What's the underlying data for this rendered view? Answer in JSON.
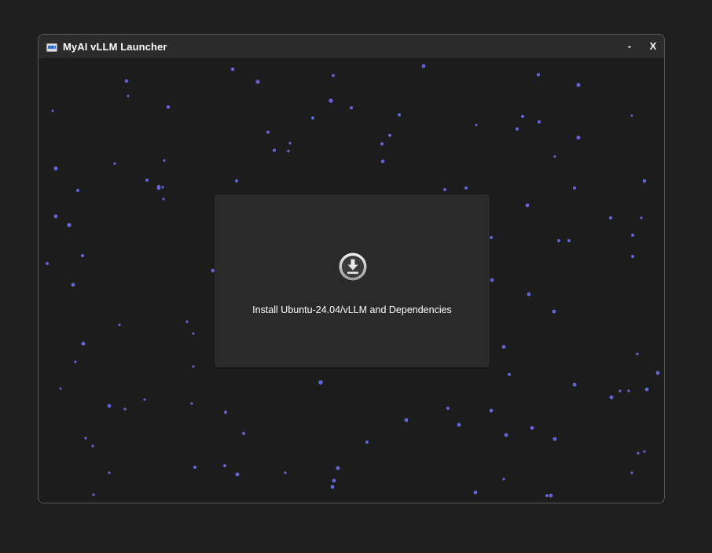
{
  "window": {
    "title": "MyAI vLLM Launcher",
    "minimize_label": "-",
    "close_label": "X"
  },
  "main": {
    "install_button": {
      "label": "Install Ubuntu-24.04/vLLM and Dependencies",
      "icon": "download-icon"
    }
  },
  "colors": {
    "background": "#1e1e1e",
    "titlebar": "#2b2b2b",
    "star": "#6a6adf",
    "card": "#2c2c2c"
  }
}
